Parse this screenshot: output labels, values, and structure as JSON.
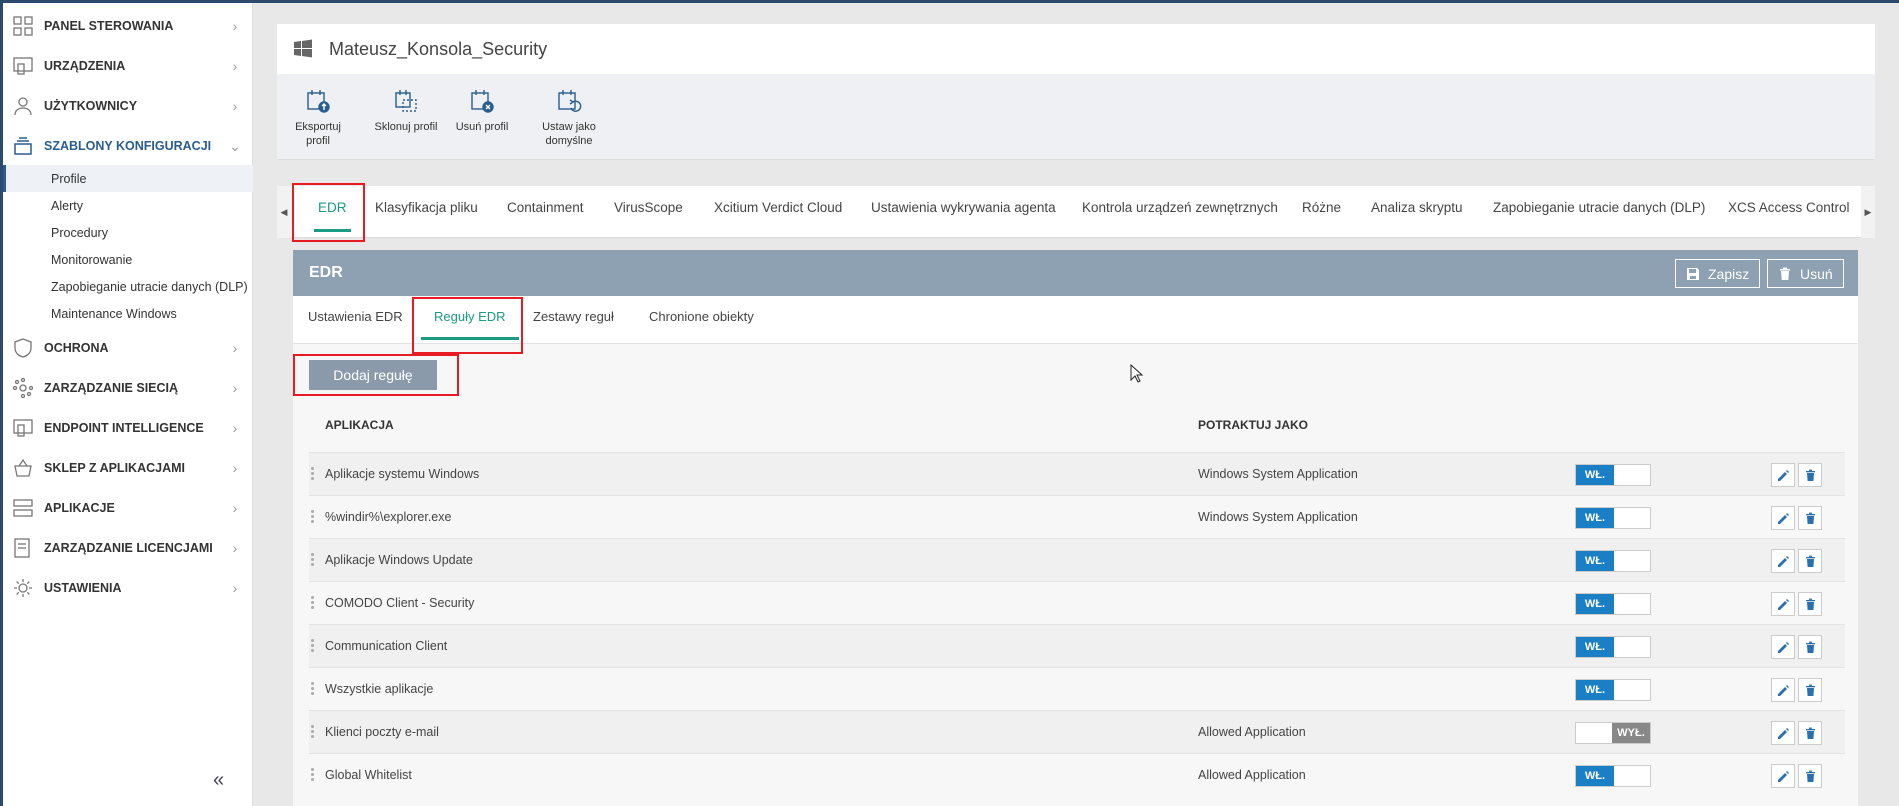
{
  "sidebar": {
    "items": [
      {
        "label": "PANEL STEROWANIA",
        "icon": "dashboard-grid-icon"
      },
      {
        "label": "URZĄDZENIA",
        "icon": "devices-icon"
      },
      {
        "label": "UŻYTKOWNICY",
        "icon": "user-icon"
      },
      {
        "label": "SZABLONY KONFIGURACJI",
        "icon": "templates-stack-icon"
      },
      {
        "label": "OCHRONA",
        "icon": "shield-icon"
      },
      {
        "label": "ZARZĄDZANIE SIECIĄ",
        "icon": "network-icon"
      },
      {
        "label": "ENDPOINT INTELLIGENCE",
        "icon": "endpoint-icon"
      },
      {
        "label": "SKLEP Z APLIKACJAMI",
        "icon": "basket-icon"
      },
      {
        "label": "APLIKACJE",
        "icon": "applications-icon"
      },
      {
        "label": "ZARZĄDZANIE LICENCJAMI",
        "icon": "license-icon"
      },
      {
        "label": "USTAWIENIA",
        "icon": "gear-icon"
      }
    ],
    "subitems": [
      "Profile",
      "Alerty",
      "Procedury",
      "Monitorowanie",
      "Zapobieganie utracie danych (DLP)",
      "Maintenance Windows"
    ],
    "collapse_label": "«"
  },
  "header": {
    "title": "Mateusz_Konsola_Security"
  },
  "toolbar": {
    "export_label": "Eksportuj profil",
    "clone_label": "Sklonuj profil",
    "delete_label": "Usuń profil",
    "default_label_1": "Ustaw jako",
    "default_label_2": "domyślne"
  },
  "tabs": [
    "EDR",
    "Klasyfikacja pliku",
    "Containment",
    "VirusScope",
    "Xcitium Verdict Cloud",
    "Ustawienia wykrywania agenta",
    "Kontrola urządzeń zewnętrznych",
    "Różne",
    "Analiza skryptu",
    "Zapobieganie utracie danych (DLP)",
    "XCS Access Control"
  ],
  "tab_arrows": {
    "left": "◀",
    "right": "▶"
  },
  "edr_panel": {
    "title": "EDR",
    "save_label": "Zapisz",
    "delete_label": "Usuń",
    "subtabs": [
      "Ustawienia EDR",
      "Reguły EDR",
      "Zestawy reguł",
      "Chronione obiekty"
    ],
    "add_rule_label": "Dodaj regułę",
    "columns": {
      "application": "APLIKACJA",
      "treat_as": "POTRAKTUJ JAKO"
    },
    "rows": [
      {
        "app": "Aplikacje systemu Windows",
        "treat": "Windows System Application",
        "state": "WŁ."
      },
      {
        "app": "%windir%\\explorer.exe",
        "treat": "Windows System Application",
        "state": "WŁ."
      },
      {
        "app": "Aplikacje Windows Update",
        "treat": "",
        "state": "WŁ."
      },
      {
        "app": "COMODO Client - Security",
        "treat": "",
        "state": "WŁ."
      },
      {
        "app": "Communication Client",
        "treat": "",
        "state": "WŁ."
      },
      {
        "app": "Wszystkie aplikacje",
        "treat": "",
        "state": "WŁ."
      },
      {
        "app": "Klienci poczty e-mail",
        "treat": "Allowed Application",
        "state": "WYŁ."
      },
      {
        "app": "Global Whitelist",
        "treat": "Allowed Application",
        "state": "WŁ."
      }
    ]
  },
  "colors": {
    "accent_teal": "#1a9b83",
    "toggle_on": "#1a7fc4",
    "toggle_off": "#888888",
    "panel_header": "#8da1b2",
    "highlight": "#e51c23"
  }
}
